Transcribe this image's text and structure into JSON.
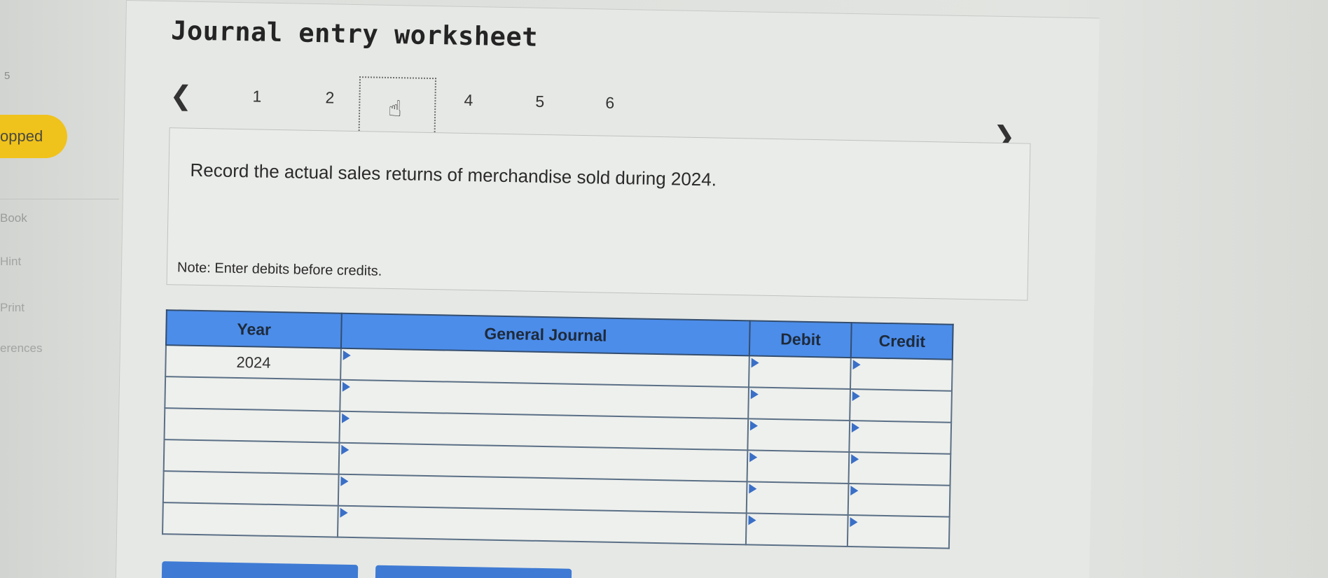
{
  "sidebar": {
    "fragment_number": "5",
    "badge_label": "opped",
    "items": [
      {
        "label": "Book"
      },
      {
        "label": "Hint"
      },
      {
        "label": "Print"
      },
      {
        "label": "erences"
      }
    ]
  },
  "worksheet": {
    "title": "Journal entry worksheet",
    "pager": {
      "prev_icon": "chevron-left-icon",
      "next_icon": "chevron-right-icon",
      "pages": [
        "1",
        "2",
        "3",
        "4",
        "5",
        "6"
      ],
      "current_page": "3"
    },
    "question": "Record the actual sales returns of merchandise sold during 2024.",
    "note": "Note: Enter debits before credits.",
    "table": {
      "headers": {
        "year": "Year",
        "general_journal": "General Journal",
        "debit": "Debit",
        "credit": "Credit"
      },
      "rows": [
        {
          "year": "2024",
          "account": "",
          "debit": "",
          "credit": ""
        },
        {
          "year": "",
          "account": "",
          "debit": "",
          "credit": ""
        },
        {
          "year": "",
          "account": "",
          "debit": "",
          "credit": ""
        },
        {
          "year": "",
          "account": "",
          "debit": "",
          "credit": ""
        },
        {
          "year": "",
          "account": "",
          "debit": "",
          "credit": ""
        },
        {
          "year": "",
          "account": "",
          "debit": "",
          "credit": ""
        }
      ]
    }
  },
  "colors": {
    "header_blue": "#4c8dea",
    "badge_yellow": "#f0c21c",
    "button_blue": "#3f7bd4"
  }
}
